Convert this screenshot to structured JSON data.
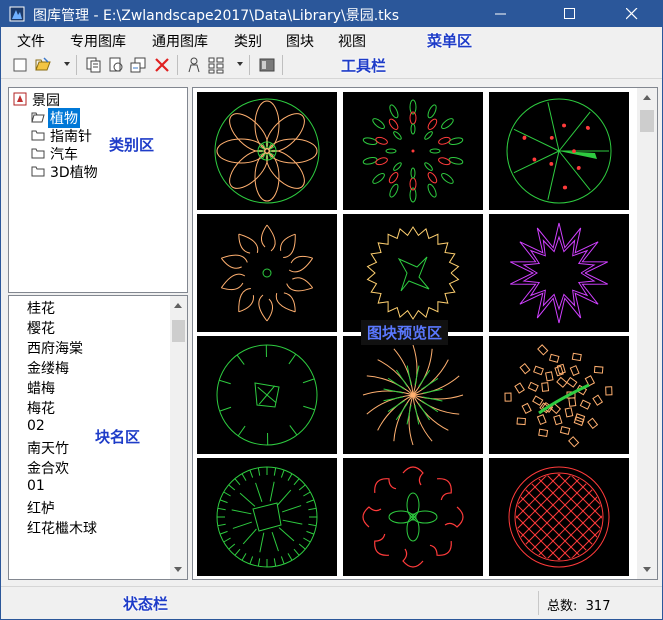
{
  "window": {
    "title": "图库管理 - E:\\Zwlandscape2017\\Data\\Library\\景园.tks"
  },
  "menu": [
    "文件",
    "专用图库",
    "通用图库",
    "类别",
    "图块",
    "视图"
  ],
  "annotations": {
    "menu_area": "菜单区",
    "toolbar_area": "工具栏",
    "category_area": "类别区",
    "block_name_area": "块名区",
    "preview_area": "图块预览区",
    "status_area": "状态栏"
  },
  "toolbar": {
    "icons": [
      "new-file-icon",
      "open-folder-icon",
      "copy-block-icon",
      "insert-block-icon",
      "rename-icon",
      "delete-icon",
      "person-icon",
      "grid-view-icon",
      "toolbar-panel-icon"
    ]
  },
  "category_tree": {
    "root": "景园",
    "children": [
      {
        "label": "植物",
        "selected": true
      },
      {
        "label": "指南针",
        "selected": false
      },
      {
        "label": "汽车",
        "selected": false
      },
      {
        "label": "3D植物",
        "selected": false
      }
    ]
  },
  "block_list": [
    "桂花",
    "樱花",
    "西府海棠",
    "金缕梅",
    "蜡梅",
    "梅花",
    "02",
    "南天竹",
    "金合欢",
    "01",
    "红栌",
    "红花檵木球"
  ],
  "preview_colors": {
    "green": "#2ecc40",
    "red": "#ff3b3b",
    "orange": "#ffb070",
    "yellow": "#ffd070",
    "magenta": "#d040ff",
    "cell_bg": "#000000"
  },
  "status": {
    "total_label": "总数:",
    "total_value": "317"
  }
}
